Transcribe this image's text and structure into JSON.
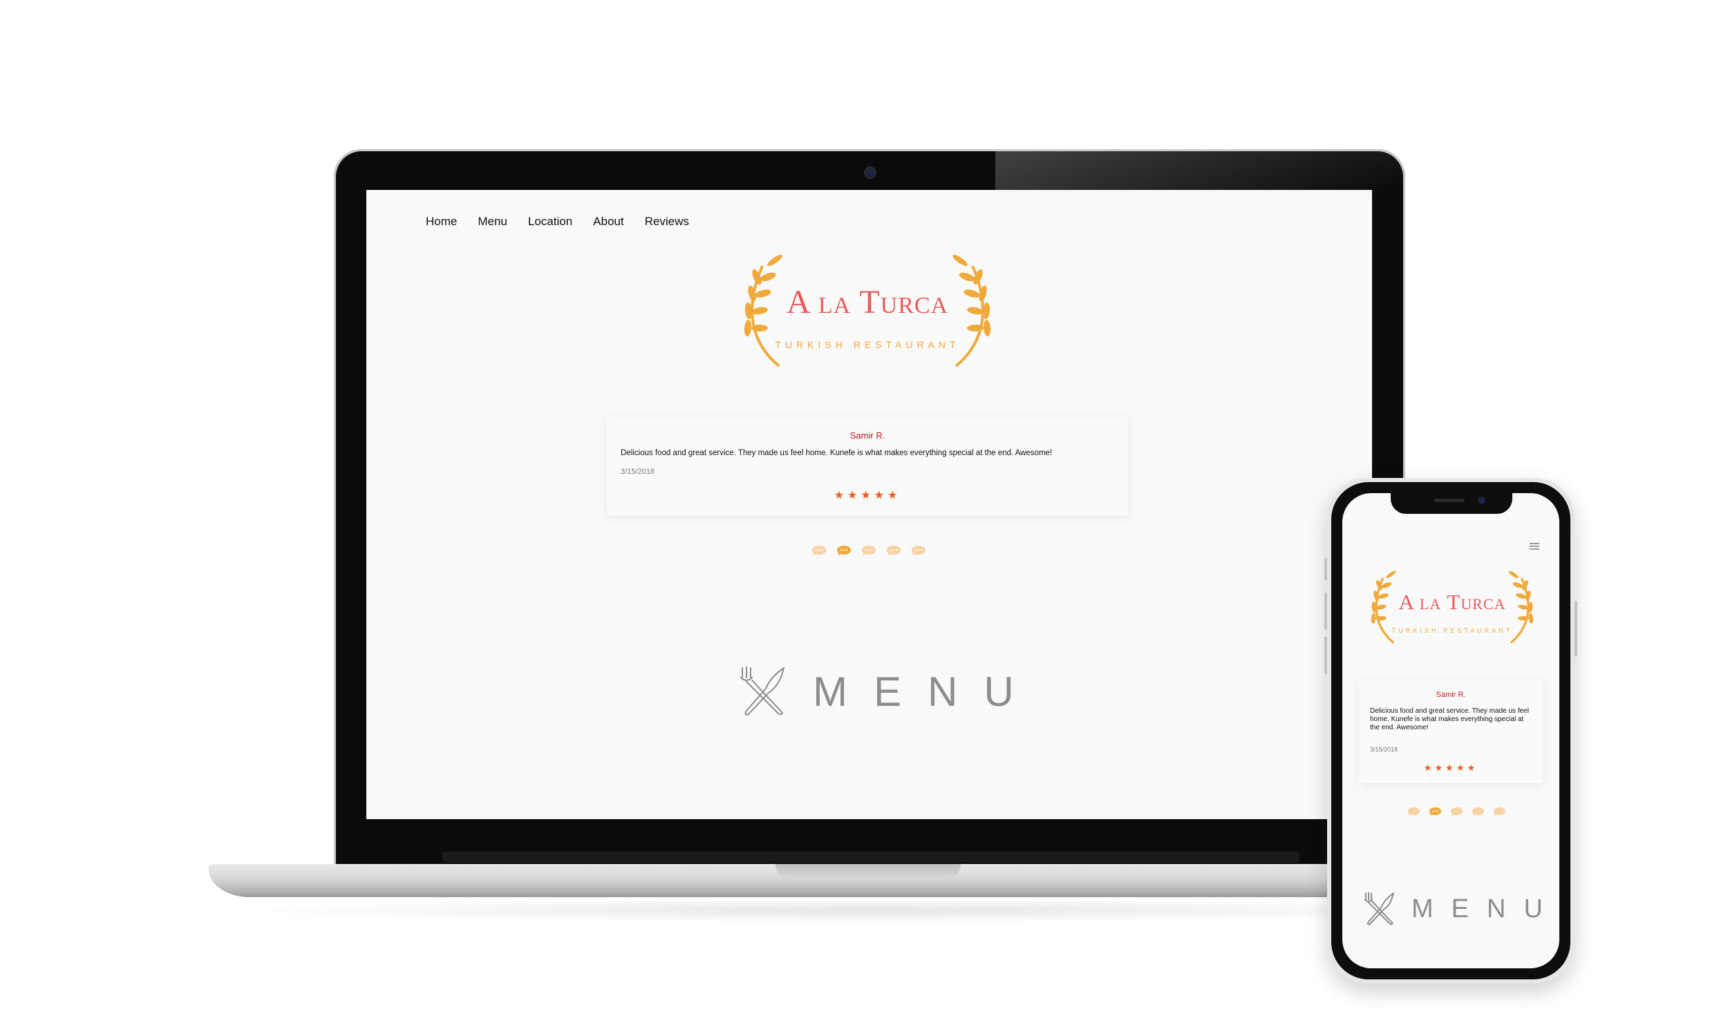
{
  "nav": {
    "items": [
      {
        "label": "Home"
      },
      {
        "label": "Menu"
      },
      {
        "label": "Location"
      },
      {
        "label": "About"
      },
      {
        "label": "Reviews"
      }
    ]
  },
  "brand": {
    "title": "A la Turca",
    "subtitle": "TURKISH RESTAURANT"
  },
  "review": {
    "name": "Samir R.",
    "text": "Delicious food and great service. They made us feel home. Kunefe is what makes everything special at the end. Awesome!",
    "date": "3/15/2018",
    "rating": 5,
    "stars": "★★★★★"
  },
  "carousel": {
    "count": 5,
    "active_index": 1
  },
  "menu_section": {
    "label": "MENU"
  },
  "icons": {
    "logo_ornament": "wheat-icon",
    "menu": "fork-knife-icon",
    "mobile_nav": "hamburger-icon",
    "carousel_dot": "chat-bubble-icon"
  },
  "colors": {
    "brand_title": "#e85b5b",
    "brand_accent": "#f0aa3c",
    "reviewer": "#c0151b",
    "star": "#f05a1a"
  }
}
